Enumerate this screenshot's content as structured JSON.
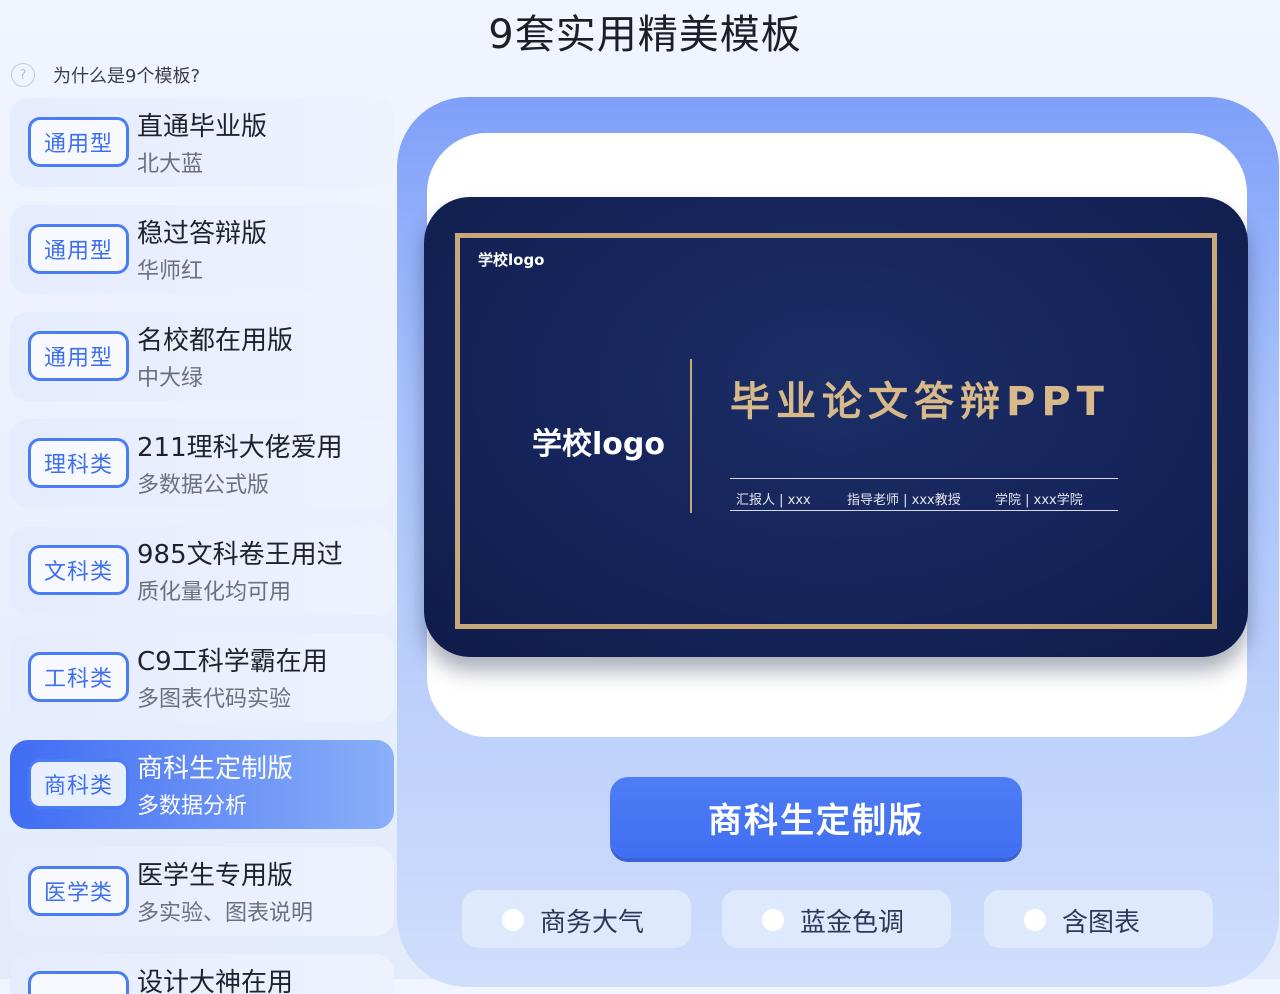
{
  "page": {
    "title": "9套实用精美模板",
    "why_label": "为什么是9个模板?",
    "why_icon": "help-circle-icon"
  },
  "cards": [
    {
      "tag": "通用型",
      "title": "直通毕业版",
      "subtitle": "北大蓝"
    },
    {
      "tag": "通用型",
      "title": "稳过答辩版",
      "subtitle": "华师红"
    },
    {
      "tag": "通用型",
      "title": "名校都在用版",
      "subtitle": "中大绿"
    },
    {
      "tag": "理科类",
      "title": "211理科大佬爱用",
      "subtitle": "多数据公式版"
    },
    {
      "tag": "文科类",
      "title": "985文科卷王用过",
      "subtitle": "质化量化均可用"
    },
    {
      "tag": "工科类",
      "title": "C9工科学霸在用",
      "subtitle": "多图表代码实验"
    },
    {
      "tag": "商科类",
      "title": "商科生定制版",
      "subtitle": "多数据分析",
      "active": true
    },
    {
      "tag": "医学类",
      "title": "医学生专用版",
      "subtitle": "多实验、图表说明"
    },
    {
      "tag": "",
      "title": "设计大神在用",
      "subtitle": ""
    }
  ],
  "preview": {
    "logo_small": "学校logo",
    "logo_big": "学校logo",
    "slide_title": "毕业论文答辩PPT",
    "meta": [
      "汇报人 | xxx",
      "指导老师 | xxx教授",
      "学院 | xxx学院"
    ]
  },
  "selected_button": "商科生定制版",
  "features": [
    "商务大气",
    "蓝金色调",
    "含图表"
  ],
  "colors": {
    "accent": "#3f6ef2",
    "slide_bg": "#15245a",
    "gold": "#c8a878"
  }
}
